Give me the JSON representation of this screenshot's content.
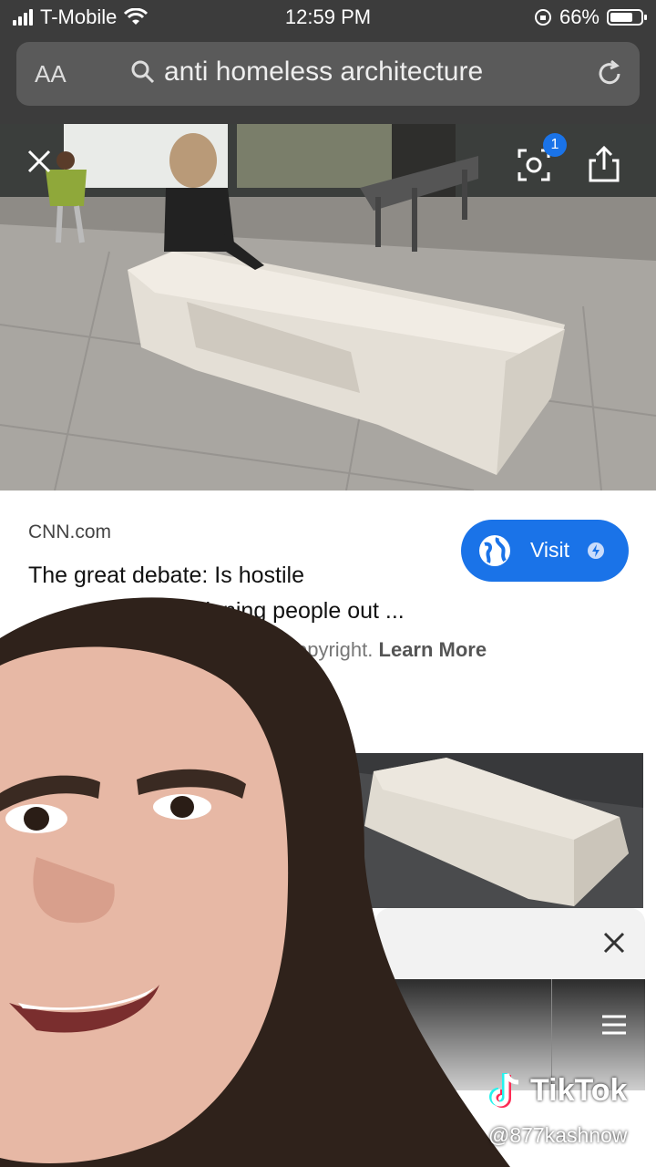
{
  "status_bar": {
    "carrier": "T-Mobile",
    "time": "12:59 PM",
    "battery": "66%"
  },
  "url_bar": {
    "text_size_label": "AA",
    "query": "anti homeless architecture"
  },
  "image_viewer": {
    "lens_badge_count": "1"
  },
  "result": {
    "source": "CNN.com",
    "title_line1": "The great debate: Is hostile",
    "title_line2": "signing people out ...",
    "copyright_text": "copyright.",
    "learn_more": "Learn More",
    "visit_label": "Visit"
  },
  "tiktok": {
    "brand": "TikTok",
    "handle": "@877kashnow"
  },
  "colors": {
    "accent": "#1a73e8",
    "statusbar": "#3c3c3c"
  },
  "icons": [
    "signal-icon",
    "wifi-icon",
    "orientation-lock-icon",
    "battery-icon",
    "search-icon",
    "reload-icon",
    "close-icon",
    "lens-icon",
    "share-icon",
    "globe-icon",
    "amp-icon",
    "menu-icon",
    "tiktok-logo"
  ]
}
